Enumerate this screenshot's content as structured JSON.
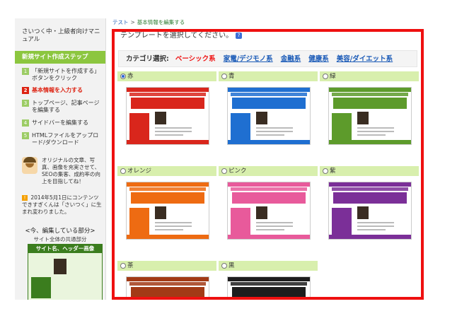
{
  "breadcrumb": {
    "root": "テスト",
    "sep": ">",
    "current": "基本情報を編集する"
  },
  "sidebar": {
    "manual": "さいつく中・上級者向けマニュアル",
    "steps_title": "新規サイト作成ステップ",
    "steps": [
      {
        "num": "1",
        "label": "「新規サイトを作成する」ボタンをクリック"
      },
      {
        "num": "2",
        "label": "基本情報を入力する",
        "active": true
      },
      {
        "num": "3",
        "label": "トップページ、記事ページを編集する"
      },
      {
        "num": "4",
        "label": "サイドバーを編集する"
      },
      {
        "num": "5",
        "label": "HTMLファイルをアップロード/ダウンロード"
      }
    ],
    "tip": "オリジナルの文章、写真、画像を充実させて、SEOの集客、成約率の向上を目指してね！",
    "notice": "2014年5月1日にコンテンツできすぎくんは「さいつく」に生まれ変わりました。",
    "editing_title": "<今、編集している部分>",
    "editing_sub": "サイト全体の共通部分",
    "preview_header": "サイト名、ヘッダー画像"
  },
  "main": {
    "title": "テンプレートを選択してください。",
    "category_label": "カテゴリ選択:",
    "categories": [
      {
        "label": "ベーシック系",
        "selected": true
      },
      {
        "label": "家電/デジモノ系"
      },
      {
        "label": "金融系"
      },
      {
        "label": "健康系"
      },
      {
        "label": "美容/ダイエット系"
      }
    ],
    "templates": [
      {
        "label": "赤",
        "color": "#d9261c",
        "selected": true
      },
      {
        "label": "青",
        "color": "#1f6fd1"
      },
      {
        "label": "緑",
        "color": "#5d9b2b"
      },
      {
        "label": "オレンジ",
        "color": "#ee6b12"
      },
      {
        "label": "ピンク",
        "color": "#e85a9b"
      },
      {
        "label": "紫",
        "color": "#7b2f98"
      },
      {
        "label": "茶",
        "color": "#a23a16"
      },
      {
        "label": "黒",
        "color": "#1d1d1d"
      }
    ]
  },
  "colors": {
    "accent_red": "#ef1010",
    "green": "#8cc63f",
    "link": "#1a5ab7"
  }
}
